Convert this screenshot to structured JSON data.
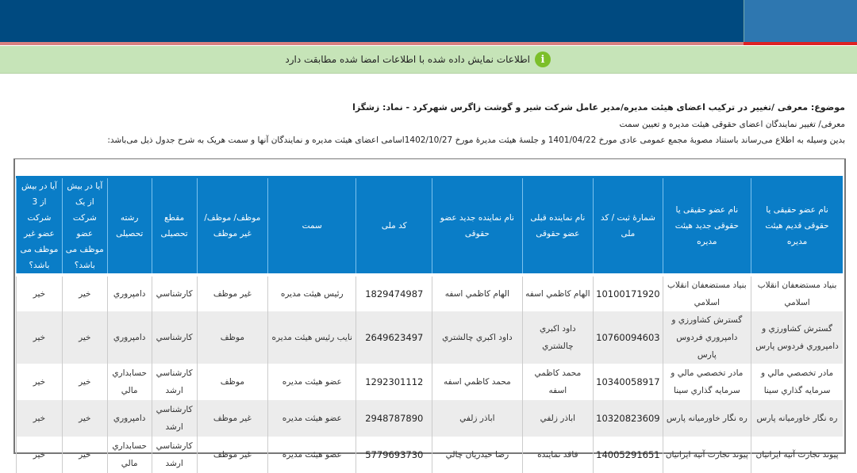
{
  "notice": {
    "text": "اطلاعات نمایش داده شده با اطلاعات امضا شده مطابقت دارد",
    "icon": "info-icon"
  },
  "subject": "موضوع: معرفی /تغییر در ترکیب اعضای هیئت مدیره/مدیر عامل شرکت شیر و گوشت زاگرس شهرکرد - نماد: زشگزا",
  "subtitle": "معرفی/ تغییر نمایندگان اعضای حقوقی هیئت مدیره و تعیین سمت",
  "intro": "بدین وسیله به اطلاع می‌رساند باستناد مصوبهٔ مجمع عمومی عادی مورخ  1401/04/22  و جلسهٔ هیئت مدیرهٔ مورخ  1402/10/27اسامی اعضای هیئت مدیره و نمایندگان آنها و سمت هریک به شرح جدول ذیل می‌باشد:",
  "table": {
    "headers": [
      "نام عضو حقیقی یا حقوقی قدیم هیئت مدیره",
      "نام عضو حقیقی یا حقوقی جدید هیئت مدیره",
      "شمارهٔ ثبت / کد ملی",
      "نام نماینده قبلی عضو حقوقی",
      "نام نماینده جدید عضو حقوقی",
      "کد ملی",
      "سمت",
      "موظف/ موظف/غیر موظف",
      "مقطع تحصیلی",
      "رشته تحصیلی",
      "آیا در بیش از یک شرکت عضو موظف می باشد؟",
      "آیا در بیش از 3 شرکت عضو غیر موظف می باشد؟"
    ],
    "rows": [
      [
        "بنیاد مستضعفان انقلاب اسلامي",
        "بنیاد مستضعفان انقلاب اسلامي",
        "10100171920",
        "الهام كاظمي اسفه",
        "الهام كاظمي اسفه",
        "1829474987",
        "رئیس هیئت مدیره",
        "غیر موظف",
        "کارشناسي",
        "دامپروري",
        "خیر",
        "خیر"
      ],
      [
        "گسترش كشاورزي و دامپروري فردوس پارس",
        "گسترش كشاورزي و دامپروري فردوس پارس",
        "10760094603",
        "داود اكبري چالشتري",
        "داود اكبري چالشتري",
        "2649623497",
        "نایب رئیس هیئت مدیره",
        "موظف",
        "کارشناسي",
        "دامپروري",
        "خیر",
        "خیر"
      ],
      [
        "مادر تخصصي مالي و سرمايه گذاري سينا",
        "مادر تخصصي مالي و سرمايه گذاري سينا",
        "10340058917",
        "محمد كاظمي اسفه",
        "محمد كاظمي اسفه",
        "1292301112",
        "عضو هیئت مدیره",
        "موظف",
        "کارشناسي ارشد",
        "حسابداري مالي",
        "خیر",
        "خیر"
      ],
      [
        "ره نگار خاورمیانه پارس",
        "ره نگار خاورمیانه پارس",
        "10320823609",
        "اباذر زلفي",
        "اباذر زلفي",
        "2948787890",
        "عضو هیئت مدیره",
        "غیر موظف",
        "کارشناسي ارشد",
        "دامپروري",
        "خیر",
        "خیر"
      ],
      [
        "پیوند تجارت آتیه ایرانیان",
        "پیوند تجارت آتیه ایرانیان",
        "14005291651",
        "فاقد نماینده",
        "رضا حیدریان چالي",
        "5779693730",
        "عضو هیئت مدیره",
        "غیر موظف",
        "کارشناسي ارشد",
        "حسابداري مالي",
        "خیر",
        "خیر"
      ]
    ]
  },
  "colors": {
    "header": "#004a80",
    "table_header": "#0a7dc7",
    "notice_bg": "#c6e4b8"
  }
}
